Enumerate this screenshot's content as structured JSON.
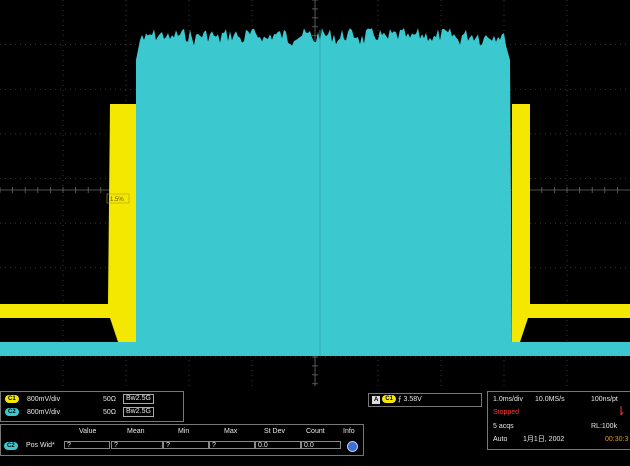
{
  "channels": [
    {
      "id": "C1",
      "scale": "800mV/div",
      "impedance": "50Ω",
      "bandwidth": "2.5G",
      "color": "#f5e800"
    },
    {
      "id": "C2",
      "scale": "800mV/div",
      "impedance": "50Ω",
      "bandwidth": "2.5G",
      "color": "#3cc8cf"
    }
  ],
  "marker_label": "1.5%",
  "trigger": {
    "source": "A",
    "channel": "C1",
    "level": "3.58V"
  },
  "acquisition": {
    "timebase": "1.0ms/div",
    "sample_rate": "10.0MS/s",
    "resolution": "100ns/pt",
    "state": "Stopped",
    "acqs": "5 acqs",
    "record_length": "RL:100k",
    "mode": "Auto",
    "date": "1月1日, 2002",
    "time": "00:30:3"
  },
  "measurement": {
    "badge": "C2",
    "name": "Pos Wid*",
    "headers": [
      "Value",
      "Mean",
      "Min",
      "Max",
      "St Dev",
      "Count",
      "Info"
    ],
    "values": [
      "?",
      "?",
      "?",
      "?",
      "0.0",
      "0.0",
      ""
    ]
  },
  "colors": {
    "ch1": "#f5e800",
    "ch2": "#3cc8cf",
    "grid": "#4a4a4a",
    "stopped": "#ff3b30"
  }
}
